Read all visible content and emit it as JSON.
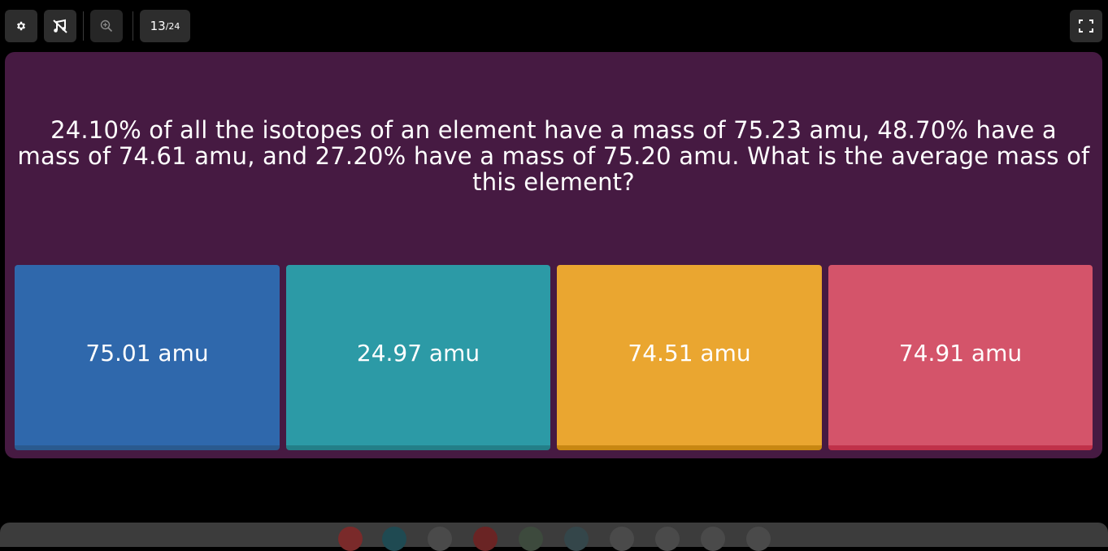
{
  "toolbar": {
    "settings_icon": "gear-icon",
    "music_icon": "music-off-icon",
    "zoom_icon": "zoom-in-icon",
    "counter": {
      "current": "13",
      "separator": "/",
      "total": "24"
    },
    "fullscreen_icon": "fullscreen-icon"
  },
  "question": {
    "text": "24.10% of all the isotopes of an element have a mass of 75.23 amu, 48.70% have a mass of 74.61 amu, and 27.20% have a mass of 75.20 amu. What is the average mass of this element?"
  },
  "options": [
    {
      "label": "75.01 amu",
      "color": "#2f68ac"
    },
    {
      "label": "24.97 amu",
      "color": "#2c9aa6"
    },
    {
      "label": "74.51 amu",
      "color": "#eaa630"
    },
    {
      "label": "74.91 amu",
      "color": "#d4546a"
    }
  ],
  "colors": {
    "background": "#000000",
    "panel": "#461a42",
    "toolbar_button": "#2d2d2d"
  }
}
